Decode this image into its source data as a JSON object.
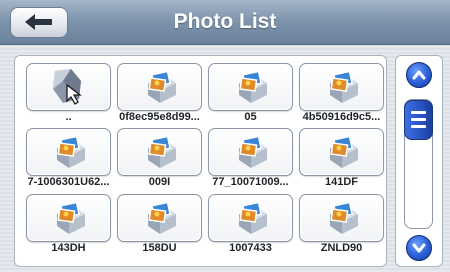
{
  "header": {
    "title": "Photo List",
    "back_icon": "back-arrow-icon"
  },
  "files": [
    {
      "name": "..",
      "type": "folder-up"
    },
    {
      "name": "0f8ec95e8d99...",
      "type": "photo"
    },
    {
      "name": "05",
      "type": "photo"
    },
    {
      "name": "4b50916d9c5...",
      "type": "photo"
    },
    {
      "name": "7-1006301U62...",
      "type": "photo"
    },
    {
      "name": "009I",
      "type": "photo"
    },
    {
      "name": "77_10071009...",
      "type": "photo"
    },
    {
      "name": "141DF",
      "type": "photo"
    },
    {
      "name": "143DH",
      "type": "photo"
    },
    {
      "name": "158DU",
      "type": "photo"
    },
    {
      "name": "1007433",
      "type": "photo"
    },
    {
      "name": "ZNLD90",
      "type": "photo"
    }
  ],
  "scrollbar": {
    "up_icon": "chevron-up-icon",
    "down_icon": "chevron-down-icon",
    "thumb_icon": "scroll-grip-icon"
  },
  "colors": {
    "header": "#7f95ad",
    "accent": "#2a5fd6"
  }
}
